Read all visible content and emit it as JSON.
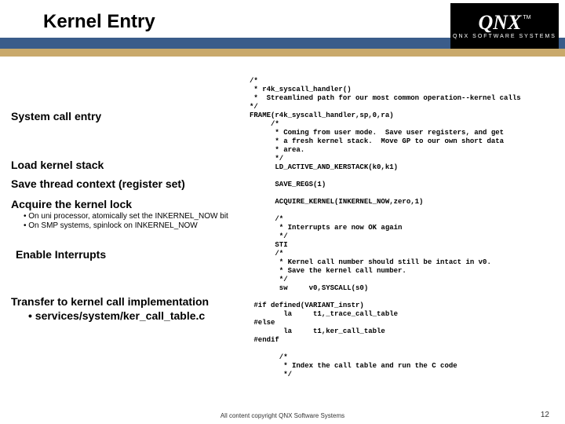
{
  "header": {
    "title": "Kernel Entry",
    "logo_main": "QNX",
    "logo_tm": "TM",
    "logo_sub": "QNX SOFTWARE SYSTEMS"
  },
  "left": {
    "syscall": "System call entry",
    "load": "Load kernel stack",
    "save": "Save thread context (register set)",
    "acquire": "Acquire the kernel lock",
    "b1": "• On uni processor, atomically set the INKERNEL_NOW bit",
    "b2": "• On SMP systems, spinlock on INKERNEL_NOW",
    "enable": "Enable Interrupts",
    "transfer": "Transfer to kernel call implementation",
    "services": "• services/system/ker_call_table.c"
  },
  "code": "/*\n * r4k_syscall_handler()\n *  Streamlined path for our most common operation--kernel calls\n*/\nFRAME(r4k_syscall_handler,sp,0,ra)\n     /*\n      * Coming from user mode.  Save user registers, and get\n      * a fresh kernel stack.  Move GP to our own short data\n      * area.\n      */\n      LD_ACTIVE_AND_KERSTACK(k0,k1)\n\n      SAVE_REGS(1)\n\n      ACQUIRE_KERNEL(INKERNEL_NOW,zero,1)\n\n      /*\n       * Interrupts are now OK again\n       */\n      STI\n      /*\n       * Kernel call number should still be intact in v0.\n       * Save the kernel call number.\n       */\n       sw     v0,SYSCALL(s0)\n\n #if defined(VARIANT_instr)\n        la     t1,_trace_call_table\n #else\n        la     t1,ker_call_table\n #endif\n\n       /*\n        * Index the call table and run the C code\n        */",
  "footer": "All content copyright QNX Software Systems",
  "pagenum": "12"
}
